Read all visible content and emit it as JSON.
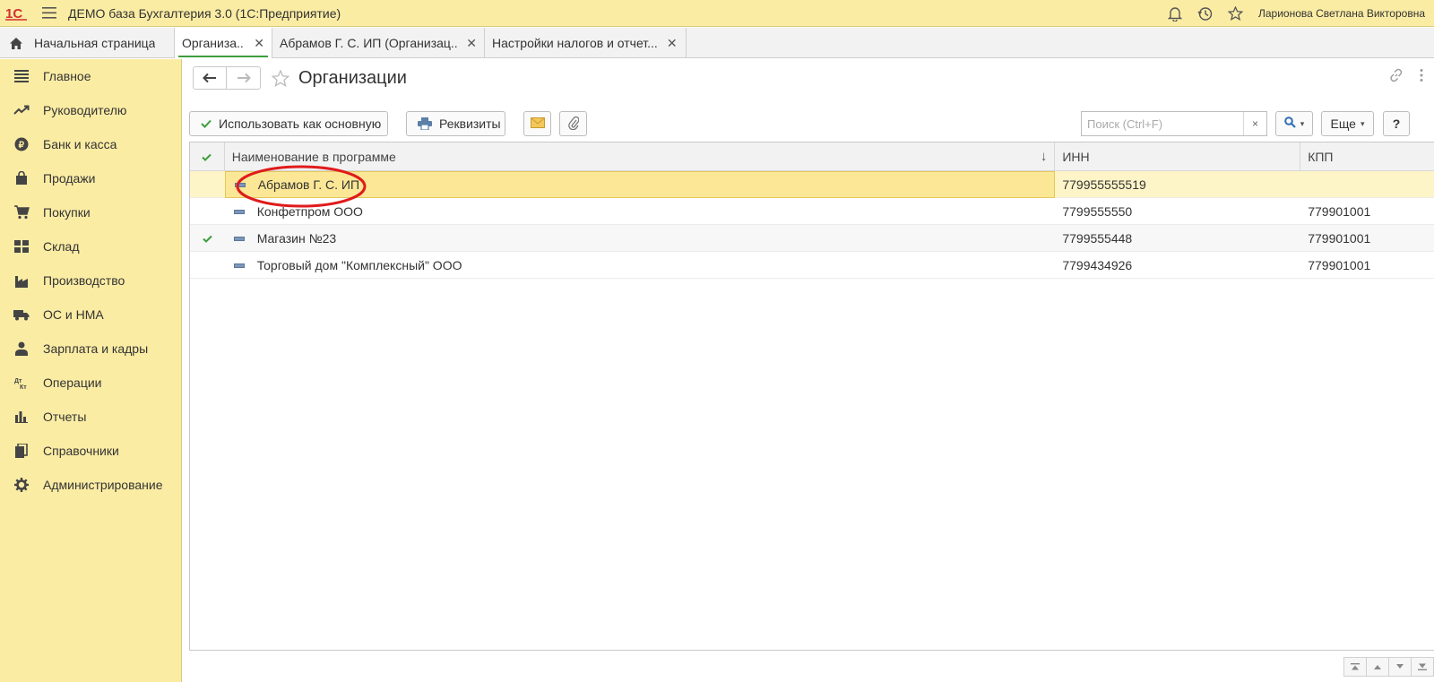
{
  "titlebar": {
    "app_title": "ДЕМО база Бухгалтерия 3.0  (1С:Предприятие)",
    "user_name": "Ларионова Светлана Викторовна"
  },
  "tabs": [
    {
      "label": "Начальная страница"
    },
    {
      "label": "Организа..."
    },
    {
      "label": "Абрамов Г. С. ИП (Организац..."
    },
    {
      "label": "Настройки налогов и отчет..."
    }
  ],
  "sidebar": {
    "items": [
      {
        "label": "Главное",
        "icon": "menu-lines-icon"
      },
      {
        "label": "Руководителю",
        "icon": "trend-icon"
      },
      {
        "label": "Банк и касса",
        "icon": "ruble-coin-icon"
      },
      {
        "label": "Продажи",
        "icon": "shopping-bag-icon"
      },
      {
        "label": "Покупки",
        "icon": "cart-icon"
      },
      {
        "label": "Склад",
        "icon": "warehouse-grid-icon"
      },
      {
        "label": "Производство",
        "icon": "factory-icon"
      },
      {
        "label": "ОС и НМА",
        "icon": "truck-icon"
      },
      {
        "label": "Зарплата и кадры",
        "icon": "person-icon"
      },
      {
        "label": "Операции",
        "icon": "dt-kt-icon"
      },
      {
        "label": "Отчеты",
        "icon": "bar-chart-icon"
      },
      {
        "label": "Справочники",
        "icon": "books-icon"
      },
      {
        "label": "Администрирование",
        "icon": "gear-icon"
      }
    ]
  },
  "main": {
    "title": "Организации",
    "toolbar": {
      "use_as_main": "Использовать как основную",
      "requisites": "Реквизиты",
      "search_placeholder": "Поиск (Ctrl+F)",
      "clear": "×",
      "more": "Еще",
      "help": "?"
    },
    "table": {
      "columns": [
        "Наименование в программе",
        "ИНН",
        "КПП"
      ],
      "rows": [
        {
          "name": "Абрамов Г. С. ИП",
          "inn": "779955555519",
          "kpp": "",
          "main": false,
          "selected": true
        },
        {
          "name": "Конфетпром ООО",
          "inn": "7799555550",
          "kpp": "779901001",
          "main": false,
          "selected": false
        },
        {
          "name": "Магазин №23",
          "inn": "7799555448",
          "kpp": "779901001",
          "main": true,
          "selected": false
        },
        {
          "name": "Торговый дом \"Комплексный\" ООО",
          "inn": "7799434926",
          "kpp": "779901001",
          "main": false,
          "selected": false
        }
      ]
    }
  },
  "colors": {
    "sidebar_bg": "#fbeca4",
    "accent_green": "#3c9e3c",
    "selection": "#fbe796",
    "annotation_red": "#e01b1b"
  }
}
